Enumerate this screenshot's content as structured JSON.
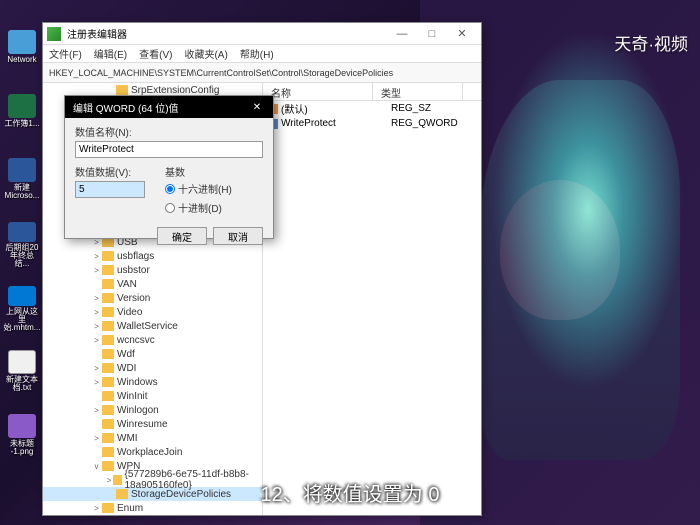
{
  "watermark": "天奇·视频",
  "caption": "12、将数值设置为 0",
  "desktop": {
    "icons": [
      "Network",
      "工作簿1...",
      "新建\nMicroso...",
      "后期组20\n年终总结...",
      "上网从这里\n始.mhtm...",
      "新建文本\n档.txt",
      "未标题\n-1.png"
    ]
  },
  "window": {
    "title": "注册表编辑器",
    "menu": [
      "文件(F)",
      "编辑(E)",
      "查看(V)",
      "收藏夹(A)",
      "帮助(H)"
    ],
    "address": "HKEY_LOCAL_MACHINE\\SYSTEM\\CurrentControlSet\\Control\\StorageDevicePolicies",
    "winbtns": [
      "—",
      "□",
      "✕"
    ],
    "tree_top": [
      "SrpExtensionConfig"
    ],
    "tree": [
      {
        "label": "USB",
        "exp": ">"
      },
      {
        "label": "usbflags",
        "exp": ">"
      },
      {
        "label": "usbstor",
        "exp": ">"
      },
      {
        "label": "VAN",
        "exp": ""
      },
      {
        "label": "Version",
        "exp": ">"
      },
      {
        "label": "Video",
        "exp": ">"
      },
      {
        "label": "WalletService",
        "exp": ">"
      },
      {
        "label": "wcncsvc",
        "exp": ">"
      },
      {
        "label": "Wdf",
        "exp": ""
      },
      {
        "label": "WDI",
        "exp": ">"
      },
      {
        "label": "Windows",
        "exp": ">"
      },
      {
        "label": "WinInit",
        "exp": ""
      },
      {
        "label": "Winlogon",
        "exp": ">"
      },
      {
        "label": "Winresume",
        "exp": ""
      },
      {
        "label": "WMI",
        "exp": ">"
      },
      {
        "label": "WorkplaceJoin",
        "exp": ""
      },
      {
        "label": "WPN",
        "exp": "v"
      }
    ],
    "tree_nested": [
      {
        "label": "{577289b6-6e75-11df-b8b8-18a905160fe0}",
        "exp": ">",
        "indent": 2
      },
      {
        "label": "StorageDevicePolicies",
        "exp": "",
        "indent": 2,
        "selected": true
      },
      {
        "label": "Enum",
        "exp": ">",
        "indent": 1
      }
    ],
    "list": {
      "headers": [
        "名称",
        "类型"
      ],
      "rows": [
        {
          "name": "(默认)",
          "type": "REG_SZ",
          "ico": "sz"
        },
        {
          "name": "WriteProtect",
          "type": "REG_QWORD",
          "ico": "qw"
        }
      ]
    }
  },
  "dialog": {
    "title": "编辑 QWORD (64 位)值",
    "name_label": "数值名称(N):",
    "name_value": "WriteProtect",
    "data_label": "数值数据(V):",
    "data_value": "5",
    "base_label": "基数",
    "radio_hex": "十六进制(H)",
    "radio_dec": "十进制(D)",
    "ok": "确定",
    "cancel": "取消"
  }
}
